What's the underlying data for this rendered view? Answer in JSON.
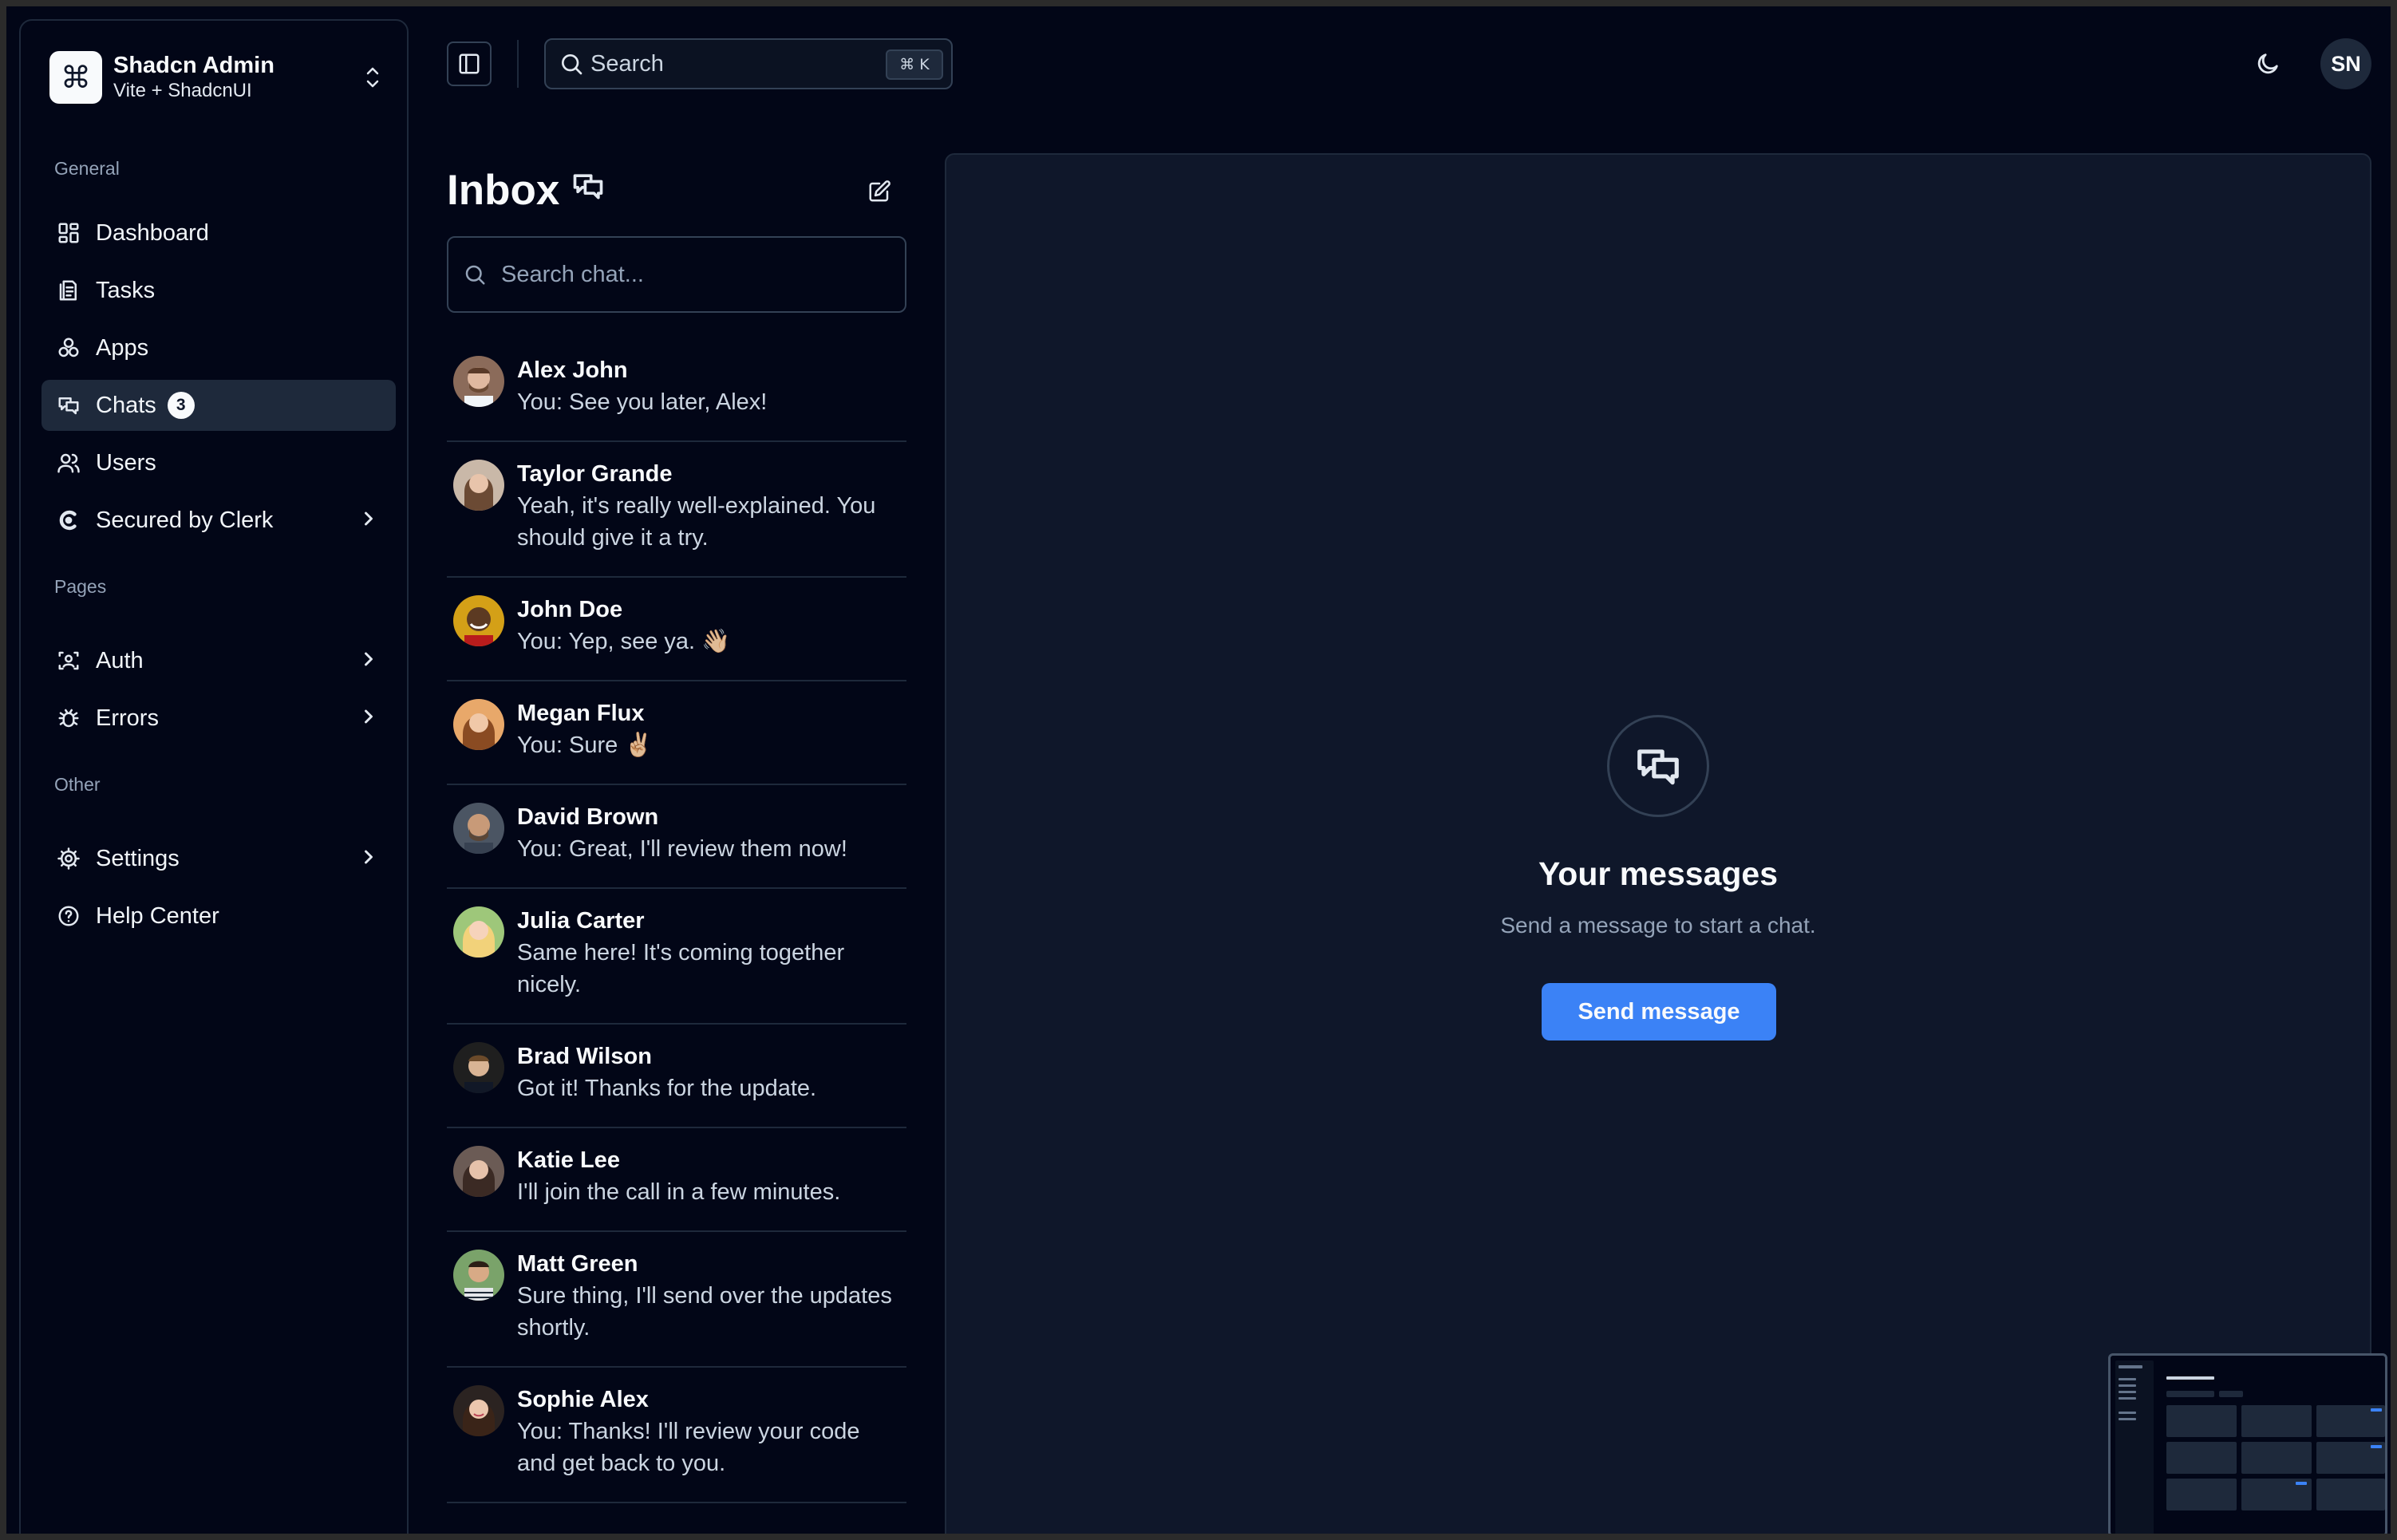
{
  "brand": {
    "title": "Shadcn Admin",
    "subtitle": "Vite + ShadcnUI",
    "logo_icon": "command-icon"
  },
  "sidebar": {
    "groups": [
      {
        "label": "General",
        "items": [
          {
            "label": "Dashboard",
            "icon": "layout-dashboard-icon"
          },
          {
            "label": "Tasks",
            "icon": "list-checks-icon"
          },
          {
            "label": "Apps",
            "icon": "packages-icon"
          },
          {
            "label": "Chats",
            "icon": "messages-icon",
            "badge": "3",
            "active": true
          },
          {
            "label": "Users",
            "icon": "users-icon"
          },
          {
            "label": "Secured by Clerk",
            "icon": "clerk-icon",
            "has_chevron": true
          }
        ]
      },
      {
        "label": "Pages",
        "items": [
          {
            "label": "Auth",
            "icon": "user-scan-icon",
            "has_chevron": true
          },
          {
            "label": "Errors",
            "icon": "bug-icon",
            "has_chevron": true
          }
        ]
      },
      {
        "label": "Other",
        "items": [
          {
            "label": "Settings",
            "icon": "settings-icon",
            "has_chevron": true
          },
          {
            "label": "Help Center",
            "icon": "help-icon"
          }
        ]
      }
    ]
  },
  "header": {
    "search_placeholder": "Search",
    "search_shortcut": "⌘ K",
    "user_initials": "SN"
  },
  "inbox": {
    "title": "Inbox",
    "search_placeholder": "Search chat...",
    "chats": [
      {
        "name": "Alex John",
        "message": "You: See you later, Alex!"
      },
      {
        "name": "Taylor Grande",
        "message": "Yeah, it's really well-explained. You should give it a try."
      },
      {
        "name": "John Doe",
        "message": "You: Yep, see ya. 👋🏼"
      },
      {
        "name": "Megan Flux",
        "message": "You: Sure ✌🏼"
      },
      {
        "name": "David Brown",
        "message": "You: Great, I'll review them now!"
      },
      {
        "name": "Julia Carter",
        "message": "Same here! It's coming together nicely."
      },
      {
        "name": "Brad Wilson",
        "message": "Got it! Thanks for the update."
      },
      {
        "name": "Katie Lee",
        "message": "I'll join the call in a few minutes."
      },
      {
        "name": "Matt Green",
        "message": "Sure thing, I'll send over the updates shortly."
      },
      {
        "name": "Sophie Alex",
        "message": "You: Thanks! I'll review your code and get back to you."
      }
    ]
  },
  "empty_state": {
    "title": "Your messages",
    "subtitle": "Send a message to start a chat.",
    "button_label": "Send message"
  },
  "colors": {
    "background": "#020617",
    "panel": "#0f172a",
    "border": "#1e293b",
    "accent": "#3b82f6"
  }
}
